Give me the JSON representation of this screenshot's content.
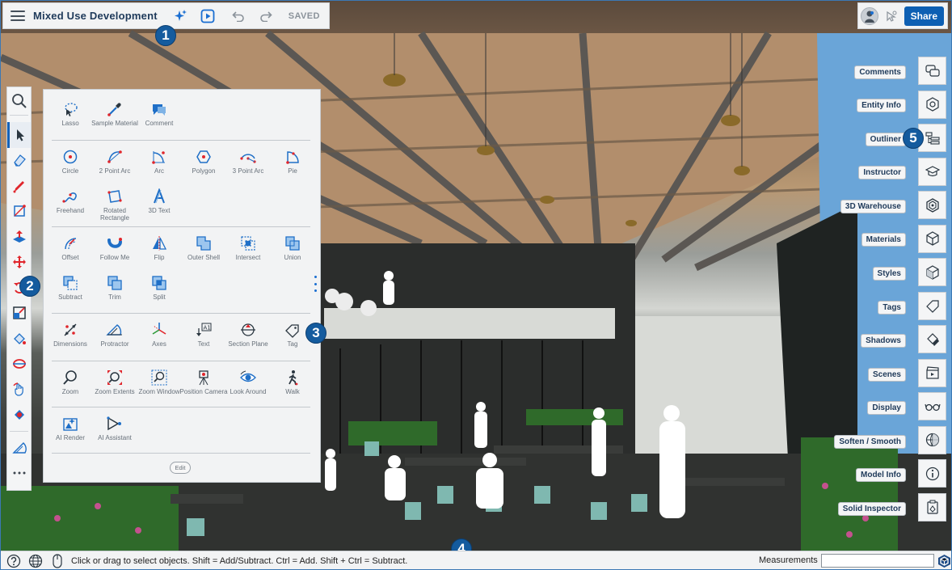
{
  "header": {
    "title": "Mixed Use Development",
    "status": "SAVED"
  },
  "topright": {
    "share_label": "Share"
  },
  "panel": {
    "sections": [
      {
        "tools": [
          {
            "id": "lasso",
            "label": "Lasso"
          },
          {
            "id": "sample-material",
            "label": "Sample Material"
          },
          {
            "id": "comment",
            "label": "Comment"
          }
        ]
      },
      {
        "tools": [
          {
            "id": "circle",
            "label": "Circle"
          },
          {
            "id": "2-point-arc",
            "label": "2 Point Arc"
          },
          {
            "id": "arc",
            "label": "Arc"
          },
          {
            "id": "polygon",
            "label": "Polygon"
          },
          {
            "id": "3-point-arc",
            "label": "3 Point Arc"
          },
          {
            "id": "pie",
            "label": "Pie"
          },
          {
            "id": "freehand",
            "label": "Freehand"
          },
          {
            "id": "rotated-rectangle",
            "label": "Rotated Rectangle"
          },
          {
            "id": "3d-text",
            "label": "3D Text"
          }
        ]
      },
      {
        "tools": [
          {
            "id": "offset",
            "label": "Offset"
          },
          {
            "id": "follow-me",
            "label": "Follow Me"
          },
          {
            "id": "flip",
            "label": "Flip"
          },
          {
            "id": "outer-shell",
            "label": "Outer Shell"
          },
          {
            "id": "intersect",
            "label": "Intersect"
          },
          {
            "id": "union",
            "label": "Union"
          },
          {
            "id": "subtract",
            "label": "Subtract"
          },
          {
            "id": "trim",
            "label": "Trim"
          },
          {
            "id": "split",
            "label": "Split"
          }
        ]
      },
      {
        "tools": [
          {
            "id": "dimensions",
            "label": "Dimensions"
          },
          {
            "id": "protractor",
            "label": "Protractor"
          },
          {
            "id": "axes",
            "label": "Axes"
          },
          {
            "id": "text",
            "label": "Text"
          },
          {
            "id": "section-plane",
            "label": "Section Plane"
          },
          {
            "id": "tag",
            "label": "Tag"
          }
        ]
      },
      {
        "tools": [
          {
            "id": "zoom",
            "label": "Zoom"
          },
          {
            "id": "zoom-extents",
            "label": "Zoom Extents"
          },
          {
            "id": "zoom-window",
            "label": "Zoom Window"
          },
          {
            "id": "position-camera",
            "label": "Position Camera"
          },
          {
            "id": "look-around",
            "label": "Look Around"
          },
          {
            "id": "walk",
            "label": "Walk"
          }
        ]
      },
      {
        "tools": [
          {
            "id": "ai-render",
            "label": "AI Render"
          },
          {
            "id": "ai-assistant",
            "label": "AI Assistant"
          }
        ]
      }
    ],
    "edit_label": "Edit"
  },
  "right_panel": {
    "items": [
      {
        "id": "comments",
        "label": "Comments"
      },
      {
        "id": "entity-info",
        "label": "Entity Info"
      },
      {
        "id": "outliner",
        "label": "Outliner"
      },
      {
        "id": "instructor",
        "label": "Instructor"
      },
      {
        "id": "3d-warehouse",
        "label": "3D Warehouse"
      },
      {
        "id": "materials",
        "label": "Materials"
      },
      {
        "id": "styles",
        "label": "Styles"
      },
      {
        "id": "tags",
        "label": "Tags"
      },
      {
        "id": "shadows",
        "label": "Shadows"
      },
      {
        "id": "scenes",
        "label": "Scenes"
      },
      {
        "id": "display",
        "label": "Display"
      },
      {
        "id": "soften-smooth",
        "label": "Soften / Smooth"
      },
      {
        "id": "model-info",
        "label": "Model Info"
      },
      {
        "id": "solid-inspector",
        "label": "Solid Inspector"
      }
    ]
  },
  "callouts": [
    "1",
    "2",
    "3",
    "4",
    "5"
  ],
  "status": {
    "hint": "Click or drag to select objects. Shift = Add/Subtract. Ctrl = Add. Shift + Ctrl = Subtract.",
    "measurements_label": "Measurements",
    "measurements_value": ""
  },
  "colors": {
    "accent": "#0d5fb3",
    "callout": "#145b9e",
    "tool_red": "#e0262c",
    "tool_blue": "#1f6fc7"
  }
}
